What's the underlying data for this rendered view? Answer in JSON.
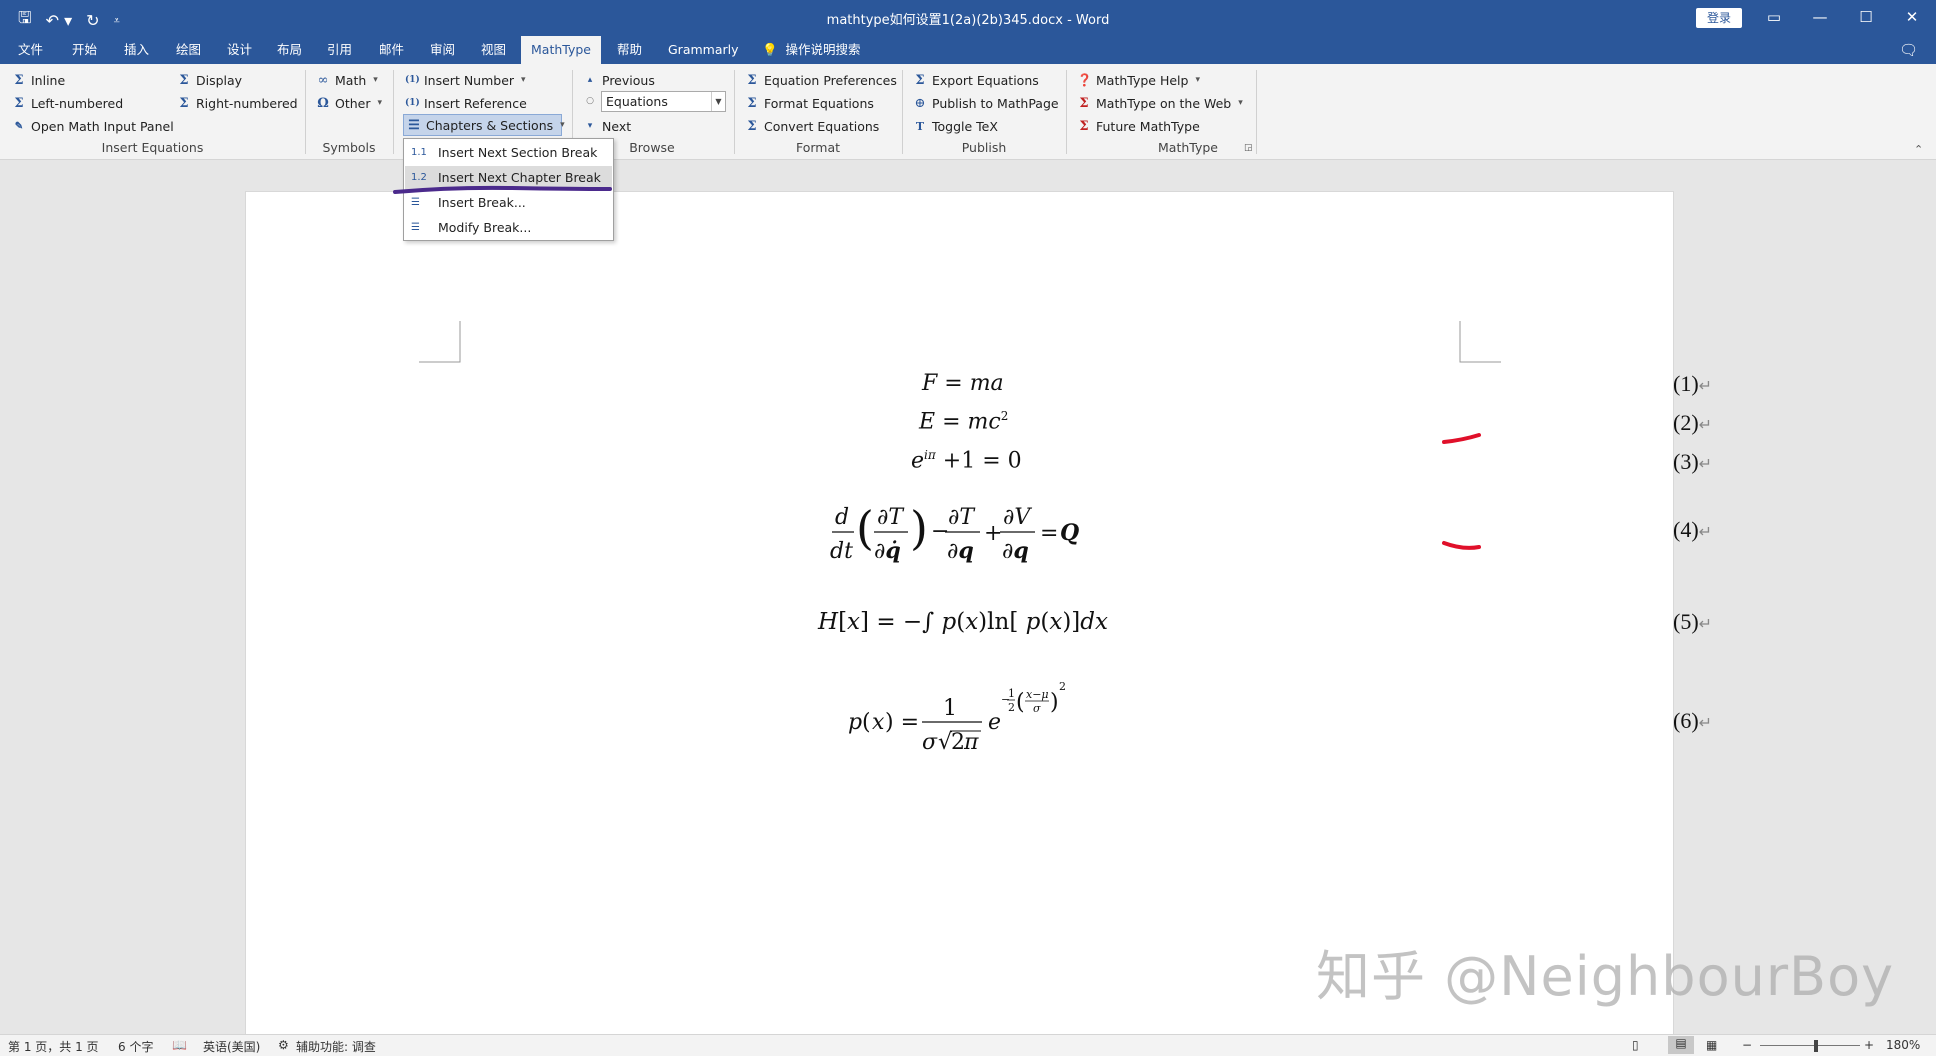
{
  "window": {
    "title": "mathtype如何设置1(2a)(2b)345.docx  -  Word",
    "login": "登录"
  },
  "tabs": [
    "文件",
    "开始",
    "插入",
    "绘图",
    "设计",
    "布局",
    "引用",
    "邮件",
    "审阅",
    "视图",
    "MathType",
    "帮助",
    "Grammarly",
    "操作说明搜索"
  ],
  "ribbon": {
    "insert_equations": {
      "label": "Insert Equations",
      "inline": "Inline",
      "display": "Display",
      "left_numbered": "Left-numbered",
      "right_numbered": "Right-numbered",
      "open_panel": "Open Math Input Panel"
    },
    "symbols": {
      "label": "Symbols",
      "math": "Math",
      "other": "Other"
    },
    "numbers": {
      "insert_number": "Insert Number",
      "insert_reference": "Insert Reference",
      "chapters_sections": "Chapters & Sections"
    },
    "browse": {
      "label": "Browse",
      "previous": "Previous",
      "combo_value": "Equations",
      "next": "Next"
    },
    "format": {
      "label": "Format",
      "equation_preferences": "Equation Preferences",
      "format_equations": "Format Equations",
      "convert_equations": "Convert Equations"
    },
    "publish": {
      "label": "Publish",
      "export": "Export Equations",
      "publish_mathpage": "Publish to MathPage",
      "toggle_tex": "Toggle TeX"
    },
    "mathtype": {
      "label": "MathType",
      "help": "MathType Help",
      "web": "MathType on the Web",
      "future": "Future MathType"
    }
  },
  "dropdown": {
    "items": [
      "Insert Next Section Break",
      "Insert Next Chapter Break",
      "Insert Break...",
      "Modify Break..."
    ],
    "highlighted_index": 1
  },
  "equations": {
    "numbers": [
      "(1)",
      "(2)",
      "(3)",
      "(4)",
      "(5)",
      "(6)"
    ]
  },
  "status": {
    "page": "第 1 页，共 1 页",
    "words": "6 个字",
    "language": "英语(美国)",
    "accessibility": "辅助功能: 调查",
    "zoom": "180%"
  },
  "watermark": "知乎 @NeighbourBoy",
  "colors": {
    "accent": "#2b579a",
    "annotation_purple": "#4b2a8c",
    "annotation_red": "#e0102a"
  }
}
